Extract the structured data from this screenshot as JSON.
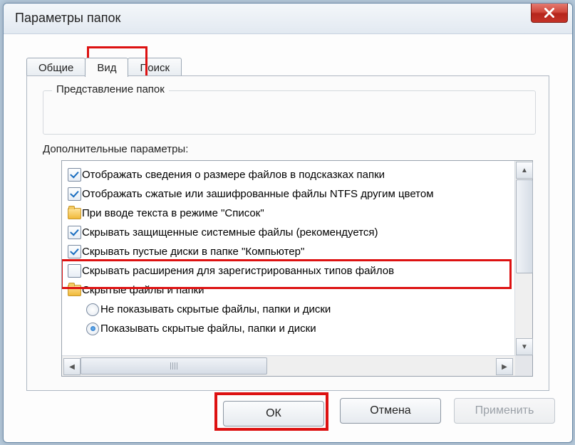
{
  "window": {
    "title": "Параметры папок"
  },
  "tabs": [
    {
      "label": "Общие"
    },
    {
      "label": "Вид"
    },
    {
      "label": "Поиск"
    }
  ],
  "groupbox": {
    "legend": "Представление папок"
  },
  "advanced": {
    "label": "Дополнительные параметры:",
    "items": [
      {
        "type": "check",
        "checked": true,
        "label": "Отображать сведения о размере файлов в подсказках папки"
      },
      {
        "type": "check",
        "checked": true,
        "label": "Отображать сжатые или зашифрованные файлы NTFS другим цветом"
      },
      {
        "type": "folder",
        "label": "При вводе текста в режиме \"Список\""
      },
      {
        "type": "check",
        "checked": true,
        "label": "Скрывать защищенные системные файлы (рекомендуется)"
      },
      {
        "type": "check",
        "checked": true,
        "label": "Скрывать пустые диски в папке \"Компьютер\""
      },
      {
        "type": "check",
        "checked": false,
        "label": "Скрывать расширения для зарегистрированных типов файлов"
      },
      {
        "type": "folder",
        "label": "Скрытые файлы и папки"
      },
      {
        "type": "radio",
        "selected": false,
        "label": "Не показывать скрытые файлы, папки и диски"
      },
      {
        "type": "radio",
        "selected": true,
        "label": "Показывать скрытые файлы, папки и диски"
      }
    ]
  },
  "buttons": {
    "ok": "ОК",
    "cancel": "Отмена",
    "apply": "Применить"
  }
}
